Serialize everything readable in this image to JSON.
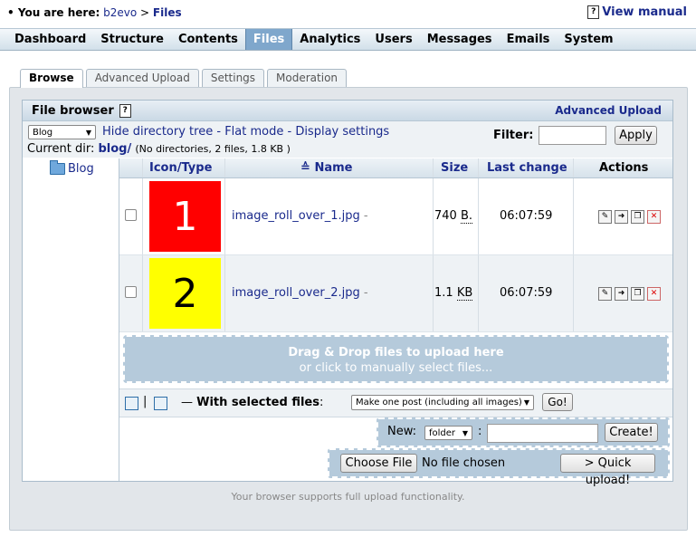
{
  "breadcrumb": {
    "prefix": "You are here:",
    "root": "b2evo",
    "sep": ">",
    "current": "Files"
  },
  "manual": {
    "label": "View manual"
  },
  "mainmenu": [
    {
      "label": "Dashboard",
      "active": false
    },
    {
      "label": "Structure",
      "active": false
    },
    {
      "label": "Contents",
      "active": false
    },
    {
      "label": "Files",
      "active": true
    },
    {
      "label": "Analytics",
      "active": false
    },
    {
      "label": "Users",
      "active": false
    },
    {
      "label": "Messages",
      "active": false
    },
    {
      "label": "Emails",
      "active": false
    },
    {
      "label": "System",
      "active": false
    }
  ],
  "tabs": [
    {
      "label": "Browse",
      "active": true
    },
    {
      "label": "Advanced Upload",
      "active": false
    },
    {
      "label": "Settings",
      "active": false
    },
    {
      "label": "Moderation",
      "active": false
    }
  ],
  "filebrowser": {
    "title": "File browser",
    "advanced_link": "Advanced Upload",
    "collection_select": "Blog",
    "links": {
      "hide_tree": "Hide directory tree",
      "sep": " - ",
      "flat_mode": "Flat mode",
      "display_settings": "Display settings"
    },
    "current_dir_label": "Current dir:",
    "current_dir": "blog/",
    "dir_meta": "(No directories, 2 files, 1.8 KB )",
    "filter_label": "Filter:",
    "apply_label": "Apply",
    "tree_root": "Blog"
  },
  "table": {
    "headers": {
      "icon_type": "Icon/Type",
      "name": "Name",
      "size": "Size",
      "last_change": "Last change",
      "actions": "Actions"
    },
    "rows": [
      {
        "thumb": "1",
        "thumb_color": "#ff0000",
        "thumb_text_color": "#ffffff",
        "name": "image_roll_over_1.jpg",
        "size_num": "740",
        "size_unit": "B.",
        "time": "06:07:59"
      },
      {
        "thumb": "2",
        "thumb_color": "#ffff00",
        "thumb_text_color": "#000000",
        "name": "image_roll_over_2.jpg",
        "size_num": "1.1",
        "size_unit": "KB",
        "time": "06:07:59"
      }
    ]
  },
  "dropzone": {
    "line1": "Drag & Drop files to upload here",
    "line2": "or click to manually select files..."
  },
  "with_selected": {
    "label": "With selected files",
    "colon": ":",
    "action_select": "Make one post (including all images)",
    "go_label": "Go!"
  },
  "new": {
    "label": "New:",
    "type_select": "folder",
    "create_label": "Create!"
  },
  "upload": {
    "choose_label": "Choose File",
    "no_file": "No file chosen",
    "quick_label": "> Quick upload!"
  },
  "footer": "Your browser supports full upload functionality."
}
